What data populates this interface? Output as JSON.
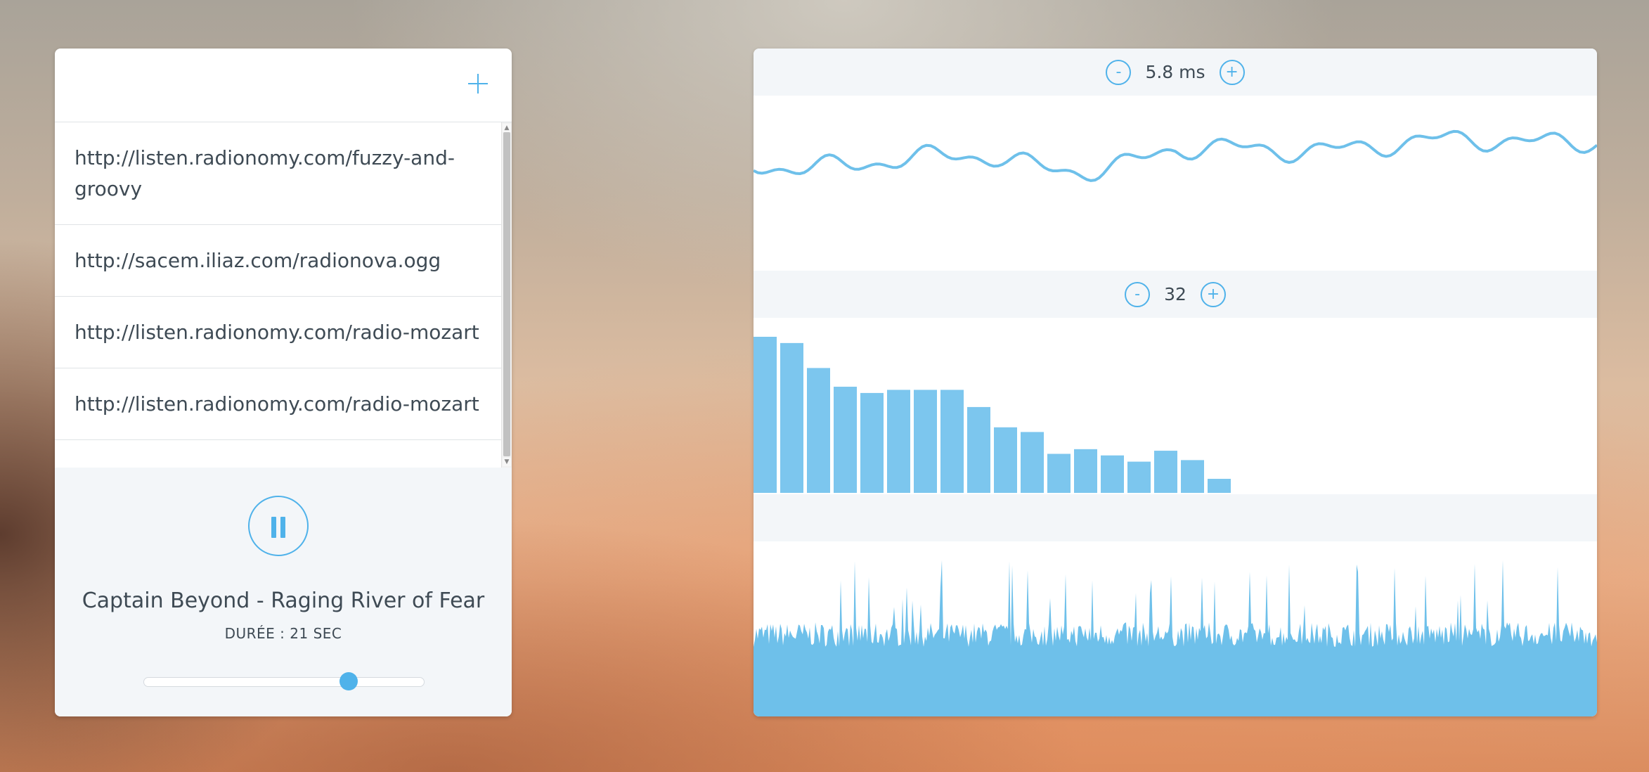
{
  "player": {
    "add_icon": "plus-icon",
    "playlist": [
      "http://listen.radionomy.com/fuzzy-and-groovy",
      "http://sacem.iliaz.com/radionova.ogg",
      "http://listen.radionomy.com/radio-mozart",
      "http://listen.radionomy.com/radio-mozart"
    ],
    "pause_icon": "pause-icon",
    "track_title": "Captain Beyond - Raging River of Fear",
    "duration": "DURÉE : 21 SEC",
    "volume_fraction": 0.73
  },
  "visualizer": {
    "waveform": {
      "minus_label": "-",
      "plus_label": "+",
      "value": "5.8 ms",
      "color": "#6ec0ea"
    },
    "spectrum": {
      "minus_label": "-",
      "plus_label": "+",
      "value": "32",
      "levels": [
        1.0,
        0.96,
        0.8,
        0.68,
        0.64,
        0.66,
        0.66,
        0.66,
        0.55,
        0.42,
        0.39,
        0.25,
        0.28,
        0.24,
        0.2,
        0.27,
        0.21,
        0.09
      ],
      "color": "#7cc6ee"
    },
    "signal": {
      "color": "#6ec0ea"
    }
  },
  "scrollbar": {
    "up_arrow": "▲",
    "down_arrow": "▼"
  }
}
